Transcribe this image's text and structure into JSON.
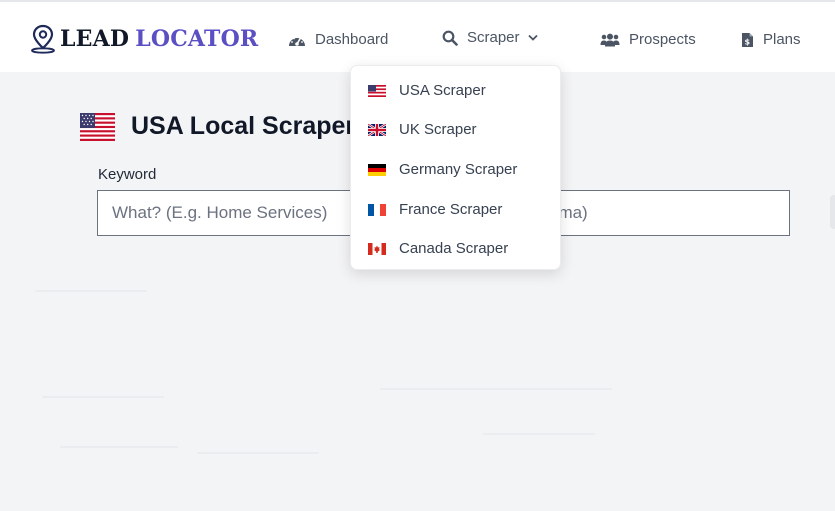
{
  "logo": {
    "part1": "LEAD",
    "part2": "LOCATOR"
  },
  "nav": {
    "dashboard": "Dashboard",
    "scraper": "Scraper",
    "prospects": "Prospects",
    "plans": "Plans"
  },
  "dropdown": {
    "items": [
      {
        "label": "USA Scraper"
      },
      {
        "label": "UK Scraper"
      },
      {
        "label": "Germany Scraper"
      },
      {
        "label": "France Scraper"
      },
      {
        "label": "Canada Scraper"
      }
    ]
  },
  "page": {
    "title": "USA Local Scraper"
  },
  "form": {
    "keyword_label": "Keyword",
    "keyword_placeholder": "What? (E.g. Home Services)",
    "location_placeholder": "g. Alabama)"
  },
  "colors": {
    "brand": "#5b4fc4",
    "background": "#f3f4f6"
  }
}
